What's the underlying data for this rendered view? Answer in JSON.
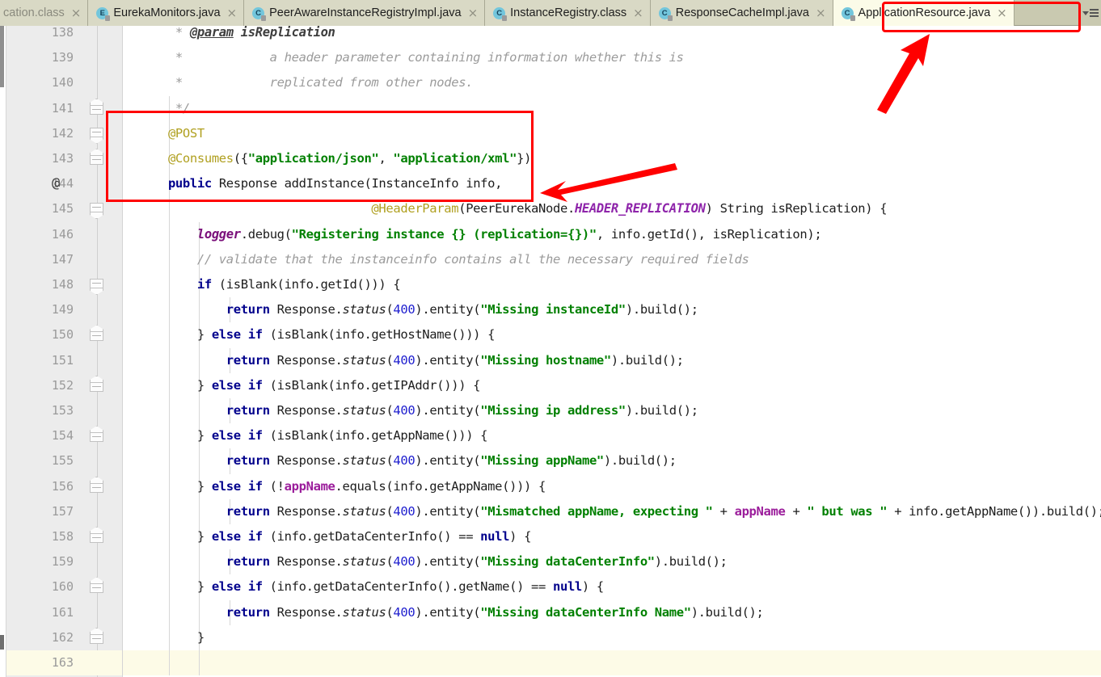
{
  "window": {
    "app": "IDE code editor",
    "accent_red": "#ff0000",
    "tab_active_bg": "#fbfbe8",
    "tabbar_bg": "#c9c9b0"
  },
  "tabs": [
    {
      "label": "cation.class",
      "icon": "class-file-icon",
      "icon_letter": "C",
      "active": false,
      "truncated": true,
      "dim": true
    },
    {
      "label": "EurekaMonitors.java",
      "icon": "enum-file-icon",
      "icon_letter": "E",
      "active": false
    },
    {
      "label": "PeerAwareInstanceRegistryImpl.java",
      "icon": "class-file-icon",
      "icon_letter": "C",
      "active": false
    },
    {
      "label": "InstanceRegistry.class",
      "icon": "class-file-icon",
      "icon_letter": "C",
      "active": false
    },
    {
      "label": "ResponseCacheImpl.java",
      "icon": "class-file-icon",
      "icon_letter": "C",
      "active": false
    },
    {
      "label": "ApplicationResource.java",
      "icon": "class-file-icon",
      "icon_letter": "C",
      "active": true
    }
  ],
  "tab_close_glyph": "×",
  "tablist_button": {
    "name": "show-tab-list-button",
    "caret": "▾"
  },
  "editor": {
    "first_line": 138,
    "caret_line": 163,
    "at_marker_line": 144,
    "at_marker_glyph": "@",
    "lines": [
      {
        "n": 138,
        "fold": null
      },
      {
        "n": 139,
        "fold": null
      },
      {
        "n": 140,
        "fold": null
      },
      {
        "n": 141,
        "fold": "up"
      },
      {
        "n": 142,
        "fold": "down"
      },
      {
        "n": 143,
        "fold": "up"
      },
      {
        "n": 144,
        "fold": null
      },
      {
        "n": 145,
        "fold": "down"
      },
      {
        "n": 146,
        "fold": null
      },
      {
        "n": 147,
        "fold": null
      },
      {
        "n": 148,
        "fold": "down"
      },
      {
        "n": 149,
        "fold": null
      },
      {
        "n": 150,
        "fold": "up"
      },
      {
        "n": 151,
        "fold": null
      },
      {
        "n": 152,
        "fold": "up"
      },
      {
        "n": 153,
        "fold": null
      },
      {
        "n": 154,
        "fold": "up"
      },
      {
        "n": 155,
        "fold": null
      },
      {
        "n": 156,
        "fold": "up"
      },
      {
        "n": 157,
        "fold": null
      },
      {
        "n": 158,
        "fold": "up"
      },
      {
        "n": 159,
        "fold": null
      },
      {
        "n": 160,
        "fold": "up"
      },
      {
        "n": 161,
        "fold": null
      },
      {
        "n": 162,
        "fold": "up"
      },
      {
        "n": 163,
        "fold": null
      }
    ],
    "source_lines": [
      "     * @param isReplication",
      "     *            a header parameter containing information whether this is",
      "     *            replicated from other nodes.",
      "     */",
      "    @POST",
      "    @Consumes({\"application/json\", \"application/xml\"})",
      "    public Response addInstance(InstanceInfo info,",
      "                                @HeaderParam(PeerEurekaNode.HEADER_REPLICATION) String isReplication) {",
      "        logger.debug(\"Registering instance {} (replication={})\", info.getId(), isReplication);",
      "        // validate that the instanceinfo contains all the necessary required fields",
      "        if (isBlank(info.getId())) {",
      "            return Response.status(400).entity(\"Missing instanceId\").build();",
      "        } else if (isBlank(info.getHostName())) {",
      "            return Response.status(400).entity(\"Missing hostname\").build();",
      "        } else if (isBlank(info.getIPAddr())) {",
      "            return Response.status(400).entity(\"Missing ip address\").build();",
      "        } else if (isBlank(info.getAppName())) {",
      "            return Response.status(400).entity(\"Missing appName\").build();",
      "        } else if (!appName.equals(info.getAppName())) {",
      "            return Response.status(400).entity(\"Mismatched appName, expecting \" + appName + \" but was \" + info.getAppName()).build();",
      "        } else if (info.getDataCenterInfo() == null) {",
      "            return Response.status(400).entity(\"Missing dataCenterInfo\").build();",
      "        } else if (info.getDataCenterInfo().getName() == null) {",
      "            return Response.status(400).entity(\"Missing dataCenterInfo Name\").build();",
      "        }",
      ""
    ]
  },
  "annotations": {
    "code_highlight_box": {
      "name": "code-highlight-box",
      "lines": "141-144",
      "color": "#ff0000"
    },
    "tab_highlight_box": {
      "name": "active-tab-highlight-box",
      "target": "ApplicationResource.java",
      "color": "#ff0000"
    },
    "arrow_to_code": {
      "name": "arrow-pointing-to-code-box",
      "color": "#ff0000"
    },
    "arrow_to_tab": {
      "name": "arrow-pointing-to-active-tab",
      "color": "#ff0000"
    }
  }
}
